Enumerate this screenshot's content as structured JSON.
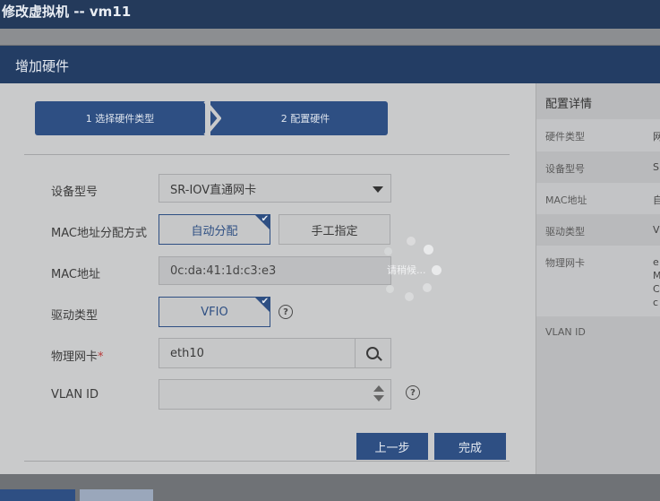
{
  "outer": {
    "title": "修改虚拟机 -- vm11"
  },
  "dialog": {
    "title": "增加硬件"
  },
  "wizard": {
    "steps": [
      {
        "label": "1 选择硬件类型"
      },
      {
        "label": "2 配置硬件"
      }
    ]
  },
  "form": {
    "device_model": {
      "label": "设备型号",
      "value": "SR-IOV直通网卡"
    },
    "mac_mode": {
      "label": "MAC地址分配方式",
      "options": [
        "自动分配",
        "手工指定"
      ],
      "selected": "自动分配"
    },
    "mac_address": {
      "label": "MAC地址",
      "value": "0c:da:41:1d:c3:e3"
    },
    "driver_type": {
      "label": "驱动类型",
      "value": "VFIO"
    },
    "physical_nic": {
      "label": "物理网卡",
      "required_mark": "*",
      "value": "eth10"
    },
    "vlan_id": {
      "label": "VLAN ID",
      "value": ""
    }
  },
  "buttons": {
    "prev": "上一步",
    "finish": "完成"
  },
  "loading": {
    "text": "请稍候..."
  },
  "details": {
    "title": "配置详情",
    "rows": [
      {
        "key": "硬件类型",
        "value": "网"
      },
      {
        "key": "设备型号",
        "value": "S"
      },
      {
        "key": "MAC地址",
        "value": "自"
      },
      {
        "key": "驱动类型",
        "value": "V"
      },
      {
        "key": "物理网卡",
        "value": "e\nM\nC\nc"
      },
      {
        "key": "VLAN ID",
        "value": ""
      }
    ]
  },
  "colors": {
    "primary": "#2e4f83",
    "header": "#233d64",
    "required": "#b83a3a"
  },
  "icons": [
    "chevron-down-icon",
    "check-icon",
    "help-icon",
    "search-icon",
    "spinner-icon"
  ]
}
